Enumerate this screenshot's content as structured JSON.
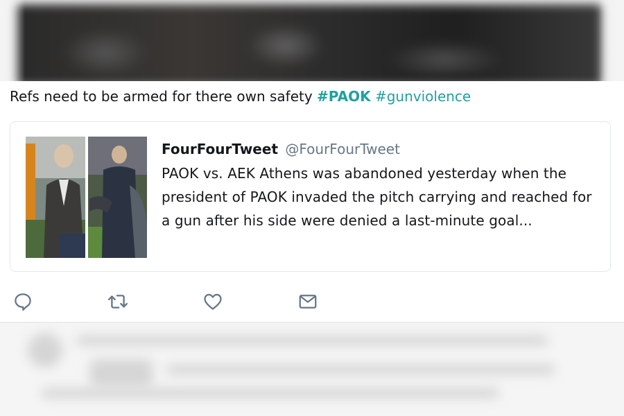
{
  "tweet": {
    "text": "Refs need to be armed for there own safety ",
    "hashtags": [
      "#PAOK",
      "#gunviolence"
    ]
  },
  "quoted_tweet": {
    "name": "FourFourTweet",
    "handle": "@FourFourTweet",
    "text": "PAOK vs. AEK Athens was abandoned yesterday when the president of PAOK invaded the pitch carrying and reached for a gun after his side were denied a last-minute goal..."
  },
  "actions": [
    {
      "name": "reply",
      "icon": "reply-icon"
    },
    {
      "name": "retweet",
      "icon": "retweet-icon"
    },
    {
      "name": "like",
      "icon": "heart-icon"
    },
    {
      "name": "message",
      "icon": "envelope-icon"
    }
  ],
  "colors": {
    "hashtag": "#1da1a1",
    "icon": "#657786",
    "text": "#14171a",
    "handle": "#657786",
    "border": "#e1e8ed"
  }
}
